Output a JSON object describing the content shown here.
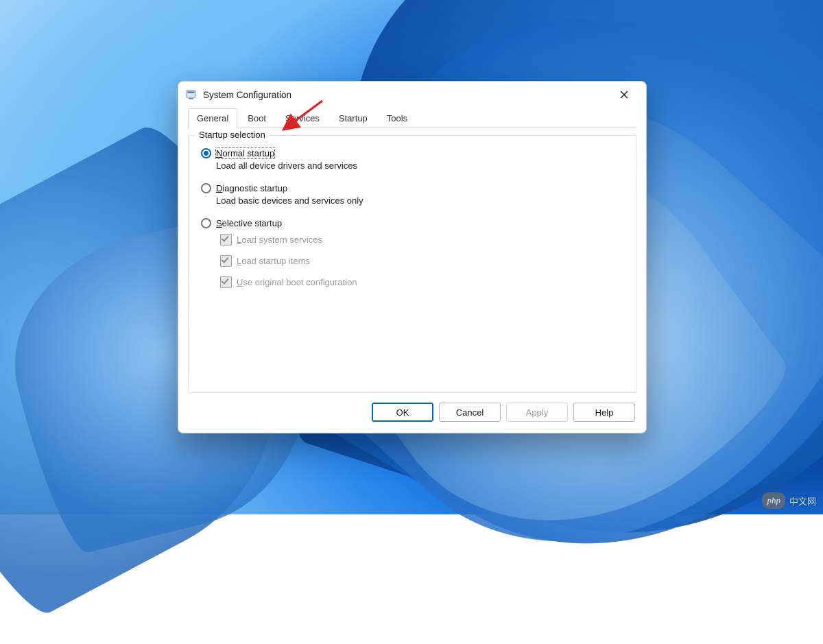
{
  "window": {
    "title": "System Configuration",
    "tabs": [
      "General",
      "Boot",
      "Services",
      "Startup",
      "Tools"
    ],
    "active_tab_index": 0
  },
  "group": {
    "legend": "Startup selection",
    "radios": [
      {
        "label": "Normal startup",
        "description": "Load all device drivers and services",
        "selected": true
      },
      {
        "label": "Diagnostic startup",
        "description": "Load basic devices and services only",
        "selected": false
      },
      {
        "label": "Selective startup",
        "description": "",
        "selected": false
      }
    ],
    "selective_checks": [
      {
        "label": "Load system services",
        "checked": true,
        "enabled": false
      },
      {
        "label": "Load startup items",
        "checked": true,
        "enabled": false
      },
      {
        "label": "Use original boot configuration",
        "checked": true,
        "enabled": false
      }
    ]
  },
  "buttons": {
    "ok": "OK",
    "cancel": "Cancel",
    "apply": "Apply",
    "help": "Help"
  },
  "watermark": {
    "badge": "php",
    "text": "中文网"
  }
}
